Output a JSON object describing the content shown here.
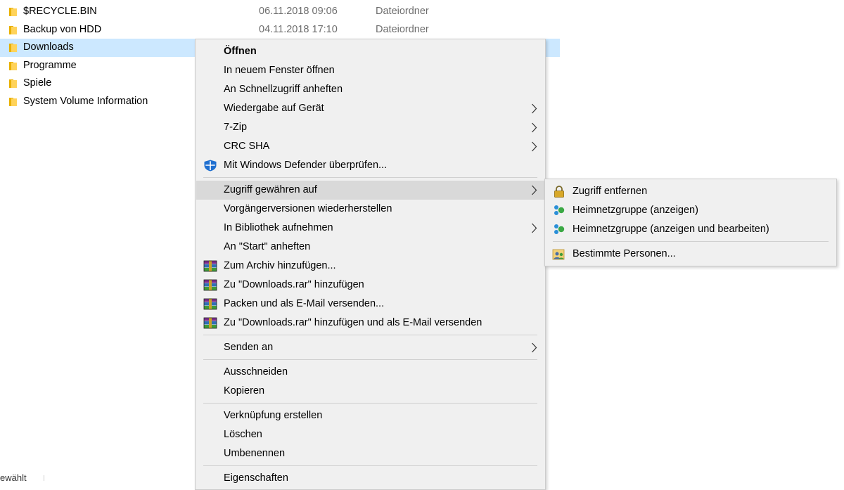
{
  "files": [
    {
      "name": "$RECYCLE.BIN",
      "date": "06.11.2018 09:06",
      "type": "Dateiordner"
    },
    {
      "name": "Backup von HDD",
      "date": "04.11.2018 17:10",
      "type": "Dateiordner"
    },
    {
      "name": "Downloads",
      "date": "",
      "type": ""
    },
    {
      "name": "Programme",
      "date": "",
      "type": ""
    },
    {
      "name": "Spiele",
      "date": "",
      "type": ""
    },
    {
      "name": "System Volume Information",
      "date": "",
      "type": ""
    }
  ],
  "status": {
    "fragment": "ewählt"
  },
  "context_menu": {
    "open": "Öffnen",
    "open_new_window": "In neuem Fenster öffnen",
    "pin_quick_access": "An Schnellzugriff anheften",
    "cast_to_device": "Wiedergabe auf Gerät",
    "seven_zip": "7-Zip",
    "crc_sha": "CRC SHA",
    "defender_scan": "Mit Windows Defender überprüfen...",
    "give_access": "Zugriff gewähren auf",
    "restore_versions": "Vorgängerversionen wiederherstellen",
    "include_library": "In Bibliothek aufnehmen",
    "pin_start": "An \"Start\" anheften",
    "add_archive": "Zum Archiv hinzufügen...",
    "add_rar": "Zu \"Downloads.rar\" hinzufügen",
    "compress_email": "Packen und als E-Mail versenden...",
    "add_rar_email": "Zu \"Downloads.rar\" hinzufügen und als E-Mail versenden",
    "send_to": "Senden an",
    "cut": "Ausschneiden",
    "copy": "Kopieren",
    "create_shortcut": "Verknüpfung erstellen",
    "delete": "Löschen",
    "rename": "Umbenennen",
    "properties": "Eigenschaften"
  },
  "submenu": {
    "remove_access": "Zugriff entfernen",
    "homegroup_view": "Heimnetzgruppe (anzeigen)",
    "homegroup_edit": "Heimnetzgruppe (anzeigen und bearbeiten)",
    "specific_people": "Bestimmte Personen..."
  },
  "icons": {
    "folder": "folder-icon",
    "defender": "windows-defender-shield-icon",
    "winrar": "winrar-archive-icon",
    "lock": "lock-icon",
    "homegroup": "homegroup-icon",
    "people": "people-icon",
    "submenu_arrow": "chevron-right-icon"
  },
  "colors": {
    "selection": "#cce8ff",
    "menu_bg": "#f0f0f0",
    "menu_hover": "#d9d9d9",
    "folder_yellow": "#ffd35a",
    "secondary_text": "#6d6d6d"
  }
}
